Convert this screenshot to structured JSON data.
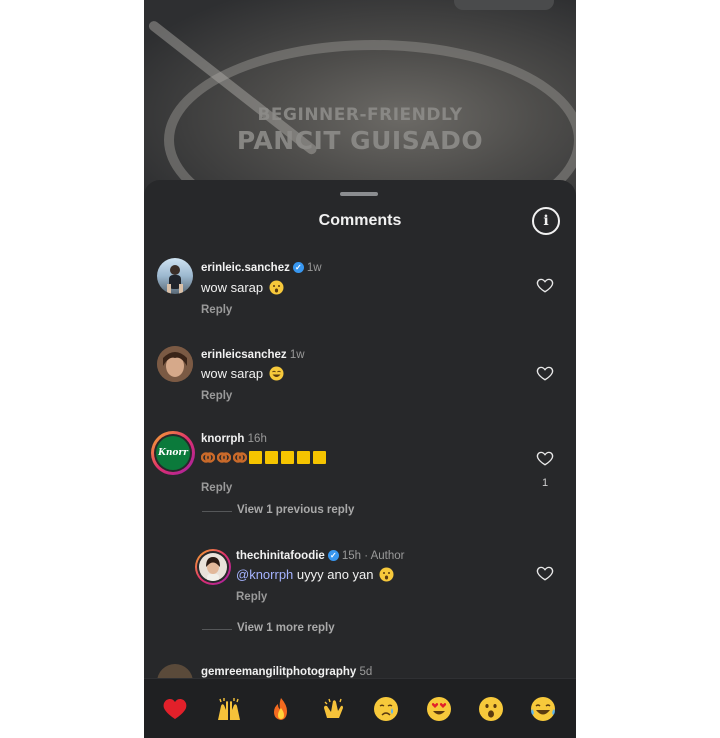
{
  "background": {
    "line1": "BEGINNER-FRIENDLY",
    "line2": "PANCIT GUISADO"
  },
  "sheet": {
    "title": "Comments",
    "info_icon": "info-icon"
  },
  "comments": [
    {
      "username": "erinleic.sanchez",
      "verified": true,
      "time": "1w",
      "text": "wow sarap",
      "emoji": "hushed-face",
      "reply": "Reply"
    },
    {
      "username": "erinleicsanchez",
      "verified": false,
      "time": "1w",
      "text": "wow sarap",
      "emoji": "grinning-face",
      "reply": "Reply"
    },
    {
      "username": "knorrph",
      "verified": false,
      "time": "16h",
      "reply": "Reply",
      "likes": "1",
      "view_replies": "View 1 previous reply",
      "avatar_text": "Knorr"
    },
    {
      "username": "thechinitafoodie",
      "verified": true,
      "time": "15h",
      "role": "· Author",
      "mention": "@knorrph",
      "text": "uyyy ano yan",
      "emoji": "hushed-face",
      "reply": "Reply",
      "view_replies": "View 1 more reply"
    },
    {
      "username": "gemreemangilitphotography",
      "time": "5d"
    }
  ],
  "emoji_bar": [
    "red-heart",
    "raising-hands",
    "fire",
    "clapping-hands",
    "crying-face",
    "heart-eyes",
    "hushed-face",
    "tears-of-joy"
  ],
  "colors": {
    "sheet": "#27282a",
    "mention": "#a5b3ff",
    "verified": "#3897f0",
    "knorr_green": "#0b7a3b"
  }
}
